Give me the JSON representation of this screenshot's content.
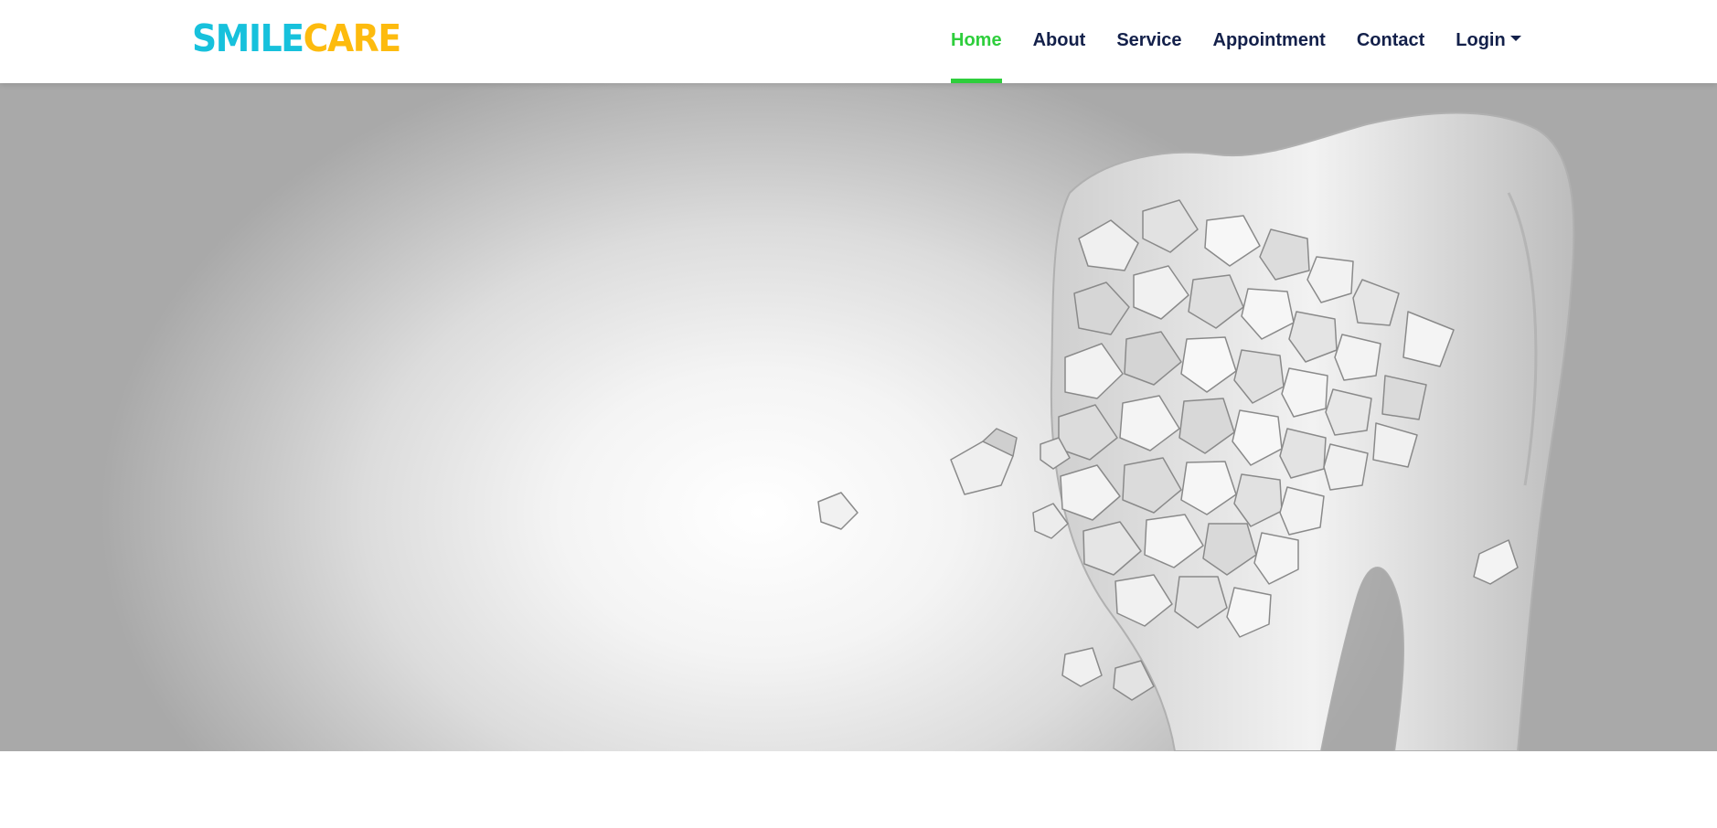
{
  "brand": {
    "part1": "SMILE",
    "part2": "CARE",
    "part1_color": "#17c1dc",
    "part2_color": "#fdbb0e"
  },
  "nav": {
    "items": [
      {
        "label": "Home",
        "active": true
      },
      {
        "label": "About"
      },
      {
        "label": "Service"
      },
      {
        "label": "Appointment"
      },
      {
        "label": "Contact"
      },
      {
        "label": "Login",
        "dropdown": true
      }
    ],
    "active_color": "#2ece3c",
    "text_color": "#13204a"
  },
  "hero": {
    "image": "shattering-tooth-illustration"
  }
}
